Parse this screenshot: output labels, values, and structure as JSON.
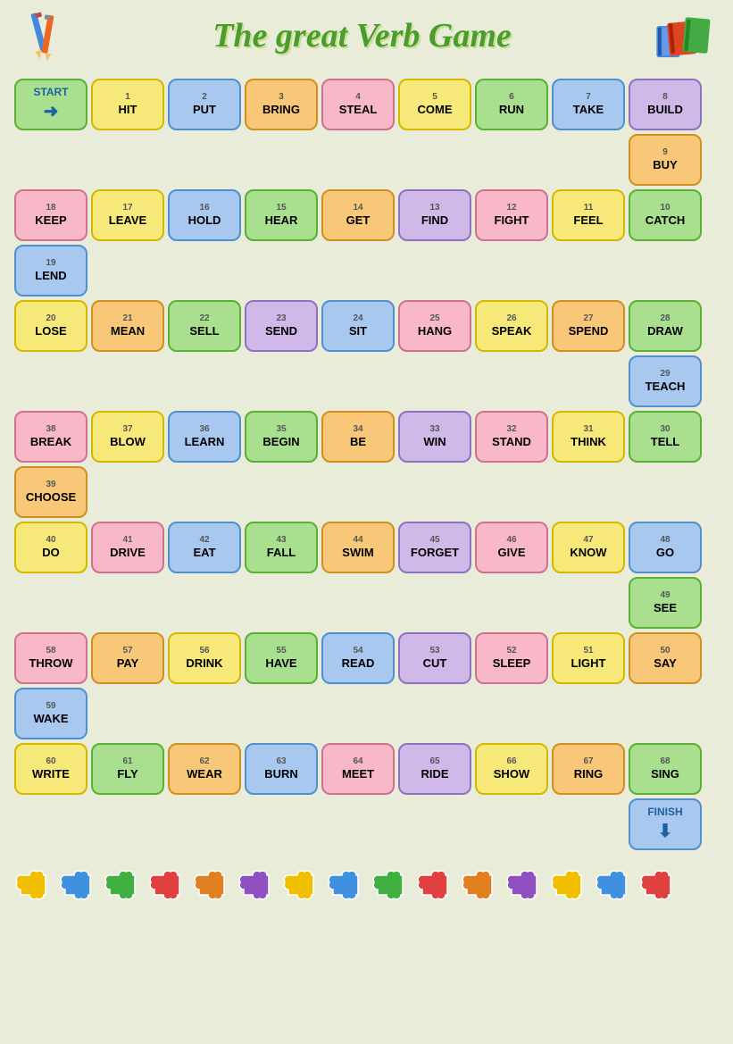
{
  "title": "The great Verb Game",
  "rows": [
    {
      "id": "row1",
      "cells": [
        {
          "id": "start",
          "type": "start",
          "num": "",
          "word": "START →",
          "color": "cell-green"
        },
        {
          "id": "c1",
          "num": "1",
          "word": "HIT",
          "color": "cell-yellow"
        },
        {
          "id": "c2",
          "num": "2",
          "word": "PUT",
          "color": "cell-blue"
        },
        {
          "id": "c3",
          "num": "3",
          "word": "BRING",
          "color": "cell-orange"
        },
        {
          "id": "c4",
          "num": "4",
          "word": "STEAL",
          "color": "cell-pink"
        },
        {
          "id": "c5",
          "num": "5",
          "word": "COME",
          "color": "cell-yellow"
        },
        {
          "id": "c6",
          "num": "6",
          "word": "RUN",
          "color": "cell-green"
        },
        {
          "id": "c7",
          "num": "7",
          "word": "TAKE",
          "color": "cell-blue"
        },
        {
          "id": "c8",
          "num": "8",
          "word": "BUILD",
          "color": "cell-purple"
        }
      ]
    },
    {
      "id": "row1b",
      "cells": [
        {
          "id": "sp1",
          "type": "spacer"
        },
        {
          "id": "sp2",
          "type": "spacer"
        },
        {
          "id": "sp3",
          "type": "spacer"
        },
        {
          "id": "sp4",
          "type": "spacer"
        },
        {
          "id": "sp5",
          "type": "spacer"
        },
        {
          "id": "sp6",
          "type": "spacer"
        },
        {
          "id": "sp7",
          "type": "spacer"
        },
        {
          "id": "sp8",
          "type": "spacer"
        },
        {
          "id": "c9",
          "num": "9",
          "word": "BUY",
          "color": "cell-orange"
        }
      ]
    },
    {
      "id": "row2",
      "cells": [
        {
          "id": "c18",
          "num": "18",
          "word": "KEEP",
          "color": "cell-pink"
        },
        {
          "id": "c17",
          "num": "17",
          "word": "LEAVE",
          "color": "cell-yellow"
        },
        {
          "id": "c16",
          "num": "16",
          "word": "HOLD",
          "color": "cell-blue"
        },
        {
          "id": "c15",
          "num": "15",
          "word": "HEAR",
          "color": "cell-green"
        },
        {
          "id": "c14",
          "num": "14",
          "word": "GET",
          "color": "cell-orange"
        },
        {
          "id": "c13",
          "num": "13",
          "word": "FIND",
          "color": "cell-purple"
        },
        {
          "id": "c12",
          "num": "12",
          "word": "FIGHT",
          "color": "cell-pink"
        },
        {
          "id": "c11",
          "num": "11",
          "word": "FEEL",
          "color": "cell-yellow"
        },
        {
          "id": "c10",
          "num": "10",
          "word": "CATCH",
          "color": "cell-green"
        }
      ]
    },
    {
      "id": "row2b",
      "cells": [
        {
          "id": "c19",
          "num": "19",
          "word": "LEND",
          "color": "cell-blue"
        },
        {
          "id": "sp10",
          "type": "spacer"
        },
        {
          "id": "sp11",
          "type": "spacer"
        },
        {
          "id": "sp12",
          "type": "spacer"
        },
        {
          "id": "sp13",
          "type": "spacer"
        },
        {
          "id": "sp14",
          "type": "spacer"
        },
        {
          "id": "sp15",
          "type": "spacer"
        },
        {
          "id": "sp16",
          "type": "spacer"
        },
        {
          "id": "sp17",
          "type": "spacer"
        }
      ]
    },
    {
      "id": "row3",
      "cells": [
        {
          "id": "c20",
          "num": "20",
          "word": "LOSE",
          "color": "cell-yellow"
        },
        {
          "id": "c21",
          "num": "21",
          "word": "MEAN",
          "color": "cell-orange"
        },
        {
          "id": "c22",
          "num": "22",
          "word": "SELL",
          "color": "cell-green"
        },
        {
          "id": "c23",
          "num": "23",
          "word": "SEND",
          "color": "cell-purple"
        },
        {
          "id": "c24",
          "num": "24",
          "word": "SIT",
          "color": "cell-blue"
        },
        {
          "id": "c25",
          "num": "25",
          "word": "HANG",
          "color": "cell-pink"
        },
        {
          "id": "c26",
          "num": "26",
          "word": "SPEAK",
          "color": "cell-yellow"
        },
        {
          "id": "c27",
          "num": "27",
          "word": "SPEND",
          "color": "cell-orange"
        },
        {
          "id": "c28",
          "num": "28",
          "word": "DRAW",
          "color": "cell-green"
        }
      ]
    },
    {
      "id": "row3b",
      "cells": [
        {
          "id": "sp18",
          "type": "spacer"
        },
        {
          "id": "sp19",
          "type": "spacer"
        },
        {
          "id": "sp20",
          "type": "spacer"
        },
        {
          "id": "sp21",
          "type": "spacer"
        },
        {
          "id": "sp22",
          "type": "spacer"
        },
        {
          "id": "sp23",
          "type": "spacer"
        },
        {
          "id": "sp24",
          "type": "spacer"
        },
        {
          "id": "sp25",
          "type": "spacer"
        },
        {
          "id": "c29",
          "num": "29",
          "word": "TEACH",
          "color": "cell-blue"
        }
      ]
    },
    {
      "id": "row4",
      "cells": [
        {
          "id": "c38",
          "num": "38",
          "word": "BREAK",
          "color": "cell-pink"
        },
        {
          "id": "c37",
          "num": "37",
          "word": "BLOW",
          "color": "cell-yellow"
        },
        {
          "id": "c36",
          "num": "36",
          "word": "LEARN",
          "color": "cell-blue"
        },
        {
          "id": "c35",
          "num": "35",
          "word": "BEGIN",
          "color": "cell-green"
        },
        {
          "id": "c34",
          "num": "34",
          "word": "BE",
          "color": "cell-orange"
        },
        {
          "id": "c33",
          "num": "33",
          "word": "WIN",
          "color": "cell-purple"
        },
        {
          "id": "c32",
          "num": "32",
          "word": "STAND",
          "color": "cell-pink"
        },
        {
          "id": "c31",
          "num": "31",
          "word": "THINK",
          "color": "cell-yellow"
        },
        {
          "id": "c30",
          "num": "30",
          "word": "TELL",
          "color": "cell-green"
        }
      ]
    },
    {
      "id": "row4b",
      "cells": [
        {
          "id": "c39",
          "num": "39",
          "word": "CHOOSE",
          "color": "cell-orange"
        },
        {
          "id": "sp26",
          "type": "spacer"
        },
        {
          "id": "sp27",
          "type": "spacer"
        },
        {
          "id": "sp28",
          "type": "spacer"
        },
        {
          "id": "sp29",
          "type": "spacer"
        },
        {
          "id": "sp30",
          "type": "spacer"
        },
        {
          "id": "sp31",
          "type": "spacer"
        },
        {
          "id": "sp32",
          "type": "spacer"
        },
        {
          "id": "sp33",
          "type": "spacer"
        }
      ]
    },
    {
      "id": "row5",
      "cells": [
        {
          "id": "c40",
          "num": "40",
          "word": "DO",
          "color": "cell-yellow"
        },
        {
          "id": "c41",
          "num": "41",
          "word": "DRIVE",
          "color": "cell-pink"
        },
        {
          "id": "c42",
          "num": "42",
          "word": "EAT",
          "color": "cell-blue"
        },
        {
          "id": "c43",
          "num": "43",
          "word": "FALL",
          "color": "cell-green"
        },
        {
          "id": "c44",
          "num": "44",
          "word": "SWIM",
          "color": "cell-orange"
        },
        {
          "id": "c45",
          "num": "45",
          "word": "FORGET",
          "color": "cell-purple"
        },
        {
          "id": "c46",
          "num": "46",
          "word": "GIVE",
          "color": "cell-pink"
        },
        {
          "id": "c47",
          "num": "47",
          "word": "KNOW",
          "color": "cell-yellow"
        },
        {
          "id": "c48",
          "num": "48",
          "word": "GO",
          "color": "cell-blue"
        }
      ]
    },
    {
      "id": "row5b",
      "cells": [
        {
          "id": "sp34",
          "type": "spacer"
        },
        {
          "id": "sp35",
          "type": "spacer"
        },
        {
          "id": "sp36",
          "type": "spacer"
        },
        {
          "id": "sp37",
          "type": "spacer"
        },
        {
          "id": "sp38",
          "type": "spacer"
        },
        {
          "id": "sp39",
          "type": "spacer"
        },
        {
          "id": "sp40",
          "type": "spacer"
        },
        {
          "id": "sp41",
          "type": "spacer"
        },
        {
          "id": "c49",
          "num": "49",
          "word": "SEE",
          "color": "cell-green"
        }
      ]
    },
    {
      "id": "row6",
      "cells": [
        {
          "id": "c58",
          "num": "58",
          "word": "THROW",
          "color": "cell-pink"
        },
        {
          "id": "c57",
          "num": "57",
          "word": "PAY",
          "color": "cell-orange"
        },
        {
          "id": "c56",
          "num": "56",
          "word": "DRINK",
          "color": "cell-yellow"
        },
        {
          "id": "c55",
          "num": "55",
          "word": "HAVE",
          "color": "cell-green"
        },
        {
          "id": "c54",
          "num": "54",
          "word": "READ",
          "color": "cell-blue"
        },
        {
          "id": "c53",
          "num": "53",
          "word": "CUT",
          "color": "cell-purple"
        },
        {
          "id": "c52",
          "num": "52",
          "word": "SLEEP",
          "color": "cell-pink"
        },
        {
          "id": "c51",
          "num": "51",
          "word": "LIGHT",
          "color": "cell-yellow"
        },
        {
          "id": "c50",
          "num": "50",
          "word": "SAY",
          "color": "cell-orange"
        }
      ]
    },
    {
      "id": "row6b",
      "cells": [
        {
          "id": "c59",
          "num": "59",
          "word": "WAKE",
          "color": "cell-blue"
        },
        {
          "id": "sp42",
          "type": "spacer"
        },
        {
          "id": "sp43",
          "type": "spacer"
        },
        {
          "id": "sp44",
          "type": "spacer"
        },
        {
          "id": "sp45",
          "type": "spacer"
        },
        {
          "id": "sp46",
          "type": "spacer"
        },
        {
          "id": "sp47",
          "type": "spacer"
        },
        {
          "id": "sp48",
          "type": "spacer"
        },
        {
          "id": "sp49",
          "type": "spacer"
        }
      ]
    },
    {
      "id": "row7",
      "cells": [
        {
          "id": "c60",
          "num": "60",
          "word": "WRITE",
          "color": "cell-yellow"
        },
        {
          "id": "c61",
          "num": "61",
          "word": "FLY",
          "color": "cell-green"
        },
        {
          "id": "c62",
          "num": "62",
          "word": "WEAR",
          "color": "cell-orange"
        },
        {
          "id": "c63",
          "num": "63",
          "word": "BURN",
          "color": "cell-blue"
        },
        {
          "id": "c64",
          "num": "64",
          "word": "MEET",
          "color": "cell-pink"
        },
        {
          "id": "c65",
          "num": "65",
          "word": "RIDE",
          "color": "cell-purple"
        },
        {
          "id": "c66",
          "num": "66",
          "word": "SHOW",
          "color": "cell-yellow"
        },
        {
          "id": "c67",
          "num": "67",
          "word": "RING",
          "color": "cell-orange"
        },
        {
          "id": "c68",
          "num": "68",
          "word": "SING",
          "color": "cell-green"
        }
      ]
    },
    {
      "id": "row7b",
      "cells": [
        {
          "id": "sp50",
          "type": "spacer"
        },
        {
          "id": "sp51",
          "type": "spacer"
        },
        {
          "id": "sp52",
          "type": "spacer"
        },
        {
          "id": "sp53",
          "type": "spacer"
        },
        {
          "id": "sp54",
          "type": "spacer"
        },
        {
          "id": "sp55",
          "type": "spacer"
        },
        {
          "id": "sp56",
          "type": "spacer"
        },
        {
          "id": "sp57",
          "type": "spacer"
        },
        {
          "id": "finish",
          "type": "finish",
          "num": "",
          "word": "FINISH ↓",
          "color": "cell-finish"
        }
      ]
    }
  ],
  "puzzle_pieces": [
    "✦",
    "✦",
    "✦",
    "✦",
    "✦",
    "✦",
    "✦",
    "✦",
    "✦",
    "✦",
    "✦",
    "✦",
    "✦",
    "✦"
  ],
  "puzzle_colors": [
    "#f0c000",
    "#4090e0",
    "#40b040",
    "#e04040",
    "#e08020",
    "#9050c0",
    "#f0c000",
    "#4090e0",
    "#40b040",
    "#e04040",
    "#e08020",
    "#9050c0",
    "#f0c000",
    "#4090e0"
  ]
}
